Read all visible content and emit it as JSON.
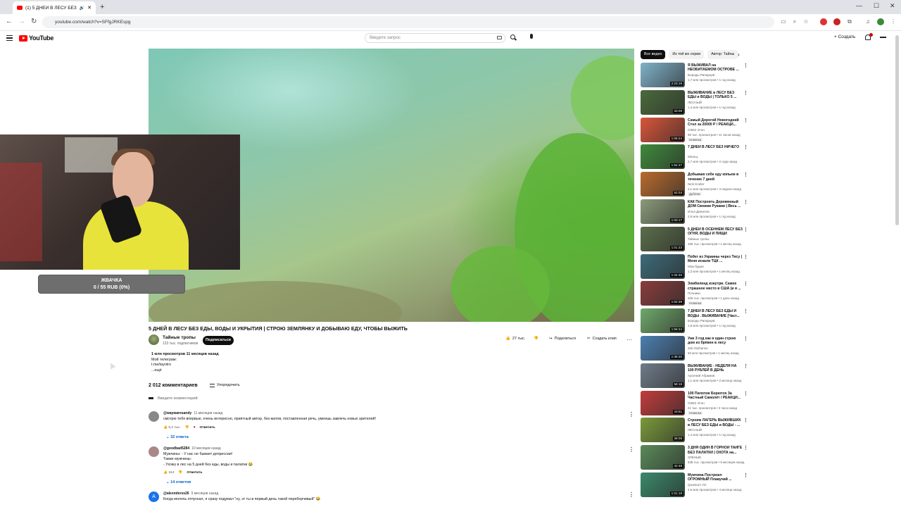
{
  "browser": {
    "tab_title": "(1) 5 ДНЕЙ В ЛЕСУ БЕЗ ЕД",
    "url": "youtube.com/watch?v=SFfgJRKEspg"
  },
  "header": {
    "logo": "YouTube",
    "search_placeholder": "Введите запрос",
    "create_label": "Создать",
    "notifications_count": "9"
  },
  "overlay": {
    "donation_title": "ЖВАЧКА",
    "donation_amount": "0 / 55 RUB (0%)",
    "donation_progress": 0
  },
  "video": {
    "title": "5 ДНЕЙ В ЛЕСУ БЕЗ ЕДЫ, ВОДЫ И УКРЫТИЯ | СТРОЮ ЗЕМЛЯНКУ И ДОБЫВАЮ ЕДУ, ЧТОБЫ ВЫЖИТЬ",
    "channel": "Тайные тропы",
    "subscribers": "123 тыс. подписчиков",
    "subscribe_label": "Подписаться",
    "likes": "27 тыс.",
    "share_label": "Поделиться",
    "clip_label": "Создать клип",
    "views_line": "1 млн просмотров  11 месяцев назад",
    "desc_lines": [
      "Мой телеграм:",
      "t.me/tayntro",
      "...ещё"
    ]
  },
  "comments": {
    "count_label": "2 012 комментариев",
    "sort_label": "Упорядочить",
    "add_placeholder": "Введите комментарий",
    "reply_label": "Ответить",
    "items": [
      {
        "author": "@waywaresandy",
        "time": "11 месяцев назад",
        "lines": [
          "смотрю тебя впервые, очень интересно, приятный автор, без матов, поставленная речь, умеешь завлечь новых зрителей!"
        ],
        "likes": "5,2 тыс.",
        "replies": "32 ответа"
      },
      {
        "author": "@goodbad5284",
        "time": "10 месяцев назад",
        "lines": [
          "Мужчины:  - У нас не бывает депрессии!",
          "Также мужчины:",
          "- Ухожу в лес на 5 дней без еды, воды и палатки 😂"
        ],
        "likes": "344",
        "replies": "14 ответов"
      },
      {
        "author": "@alexnderss26",
        "time": "9 месяцев назад",
        "lines": [
          "Когда молочь отпускал, я сразу подумал \"ну, эт ты в первый день такой переборчивый\" 😂"
        ],
        "likes": "",
        "replies": ""
      }
    ]
  },
  "sidebar": {
    "chips": [
      "Все видео",
      "Из той же серии",
      "Автор: Тайны"
    ],
    "recs": [
      {
        "title": "Я ВЫЖИВАЛ на НЕОБИТАЕМОМ ОСТРОВЕ ...",
        "channel": "Бороды Рапарцев",
        "views": "1,7 млн просмотров • 1 год назад",
        "duration": "2:23:19",
        "badge": "",
        "color": "#7fb2c9"
      },
      {
        "title": "ВЫЖИВАНИЕ в ЛЕСУ БЕЗ ЕДЫ и ВОДЫ | ТОЛЬКО 5 ...",
        "channel": "ЛЕСНЫЙ",
        "views": "1,4 млн просмотров • 1 год назад",
        "duration": "33:09",
        "badge": "",
        "color": "#4a6a3c"
      },
      {
        "title": "Самый Дорогой Новогодний Стол за 20000 Р / РЕАКЦИ...",
        "channel": "ОЗЕЗ Этон",
        "views": "95 тыс. просмотров • 11 часов назад",
        "duration": "1:06:24",
        "badge": "Новинка",
        "color": "#d9553a"
      },
      {
        "title": "7 ДНЕЙ В ЛЕСУ БЕЗ НИЧЕГО",
        "channel": "Мальц",
        "views": "2,7 млн просмотров • 2 года назад",
        "duration": "1:54:27",
        "badge": "",
        "color": "#3f8a3c"
      },
      {
        "title": "Добываю себе еду копьем в течение 7 дней",
        "channel": "Nick Kruller",
        "views": "3,1 млн просмотров • 4 недели назад",
        "duration": "52:03",
        "badge": "Дубляж",
        "color": "#b86b2e"
      },
      {
        "title": "КАК Построить Деревянный ДОМ Своими Руками | Весь ...",
        "channel": "Илья Данилов",
        "views": "2,8 млн просмотров • 1 год назад",
        "duration": "1:03:17",
        "badge": "",
        "color": "#8b9a7a"
      },
      {
        "title": "5 ДНЕЙ В ОСЕННЕМ ЛЕСУ БЕЗ ОГНЯ, ВОДЫ И ПИЩИ",
        "channel": "Тайные тропы",
        "views": "485 тыс. просмотров • 1 месяц назад",
        "duration": "1:01:23",
        "badge": "",
        "color": "#5a6e4a"
      },
      {
        "title": "Побег из Украины через Тису | Меня искали ТЦК ...",
        "channel": "Мои будни",
        "views": "1,3 млн просмотров • 1 месяц назад",
        "duration": "1:34:40",
        "badge": "",
        "color": "#3d6b7a"
      },
      {
        "title": "Зомбиленд изнутри. Самое страшное место в США (и я ...",
        "channel": "Почники",
        "views": "406 тыс. просмотров • 1 день назад",
        "duration": "1:02:39",
        "badge": "Новинка",
        "color": "#8a3c3c"
      },
      {
        "title": "7 ДНЕЙ В ЛЕСУ БЕЗ ЕДЫ И ВОДЫ . ВЫЖИВАНИЕ [Част...",
        "channel": "Бороды Рапарцев",
        "views": "1,8 млн просмотров • 1 год назад",
        "duration": "1:56:24",
        "badge": "",
        "color": "#6fa86a"
      },
      {
        "title": "Уже 3 год как я один строю дом из брёвен в лесу",
        "channel": "Jak Orphanov",
        "views": "66 млн просмотров • 1 месяц назад",
        "duration": "1:38:20",
        "badge": "",
        "color": "#4c7fb0"
      },
      {
        "title": "ВЫЖИВАНИЕ - НЕДЕЛЯ НА 100 РУБЛЕЙ В ДЕНЬ",
        "channel": "Арсений Абрамов",
        "views": "1,1 млн просмотров • 2 месяца назад",
        "duration": "58:18",
        "badge": "",
        "color": "#6f7c8a"
      },
      {
        "title": "100 Пилотов Борются За Частный Самолёт / РЕАКЦИ...",
        "channel": "ОЗЕЗ Этон",
        "views": "21 тыс. просмотров • 3 часа назад",
        "duration": "43:51",
        "badge": "Новинка",
        "color": "#c23c3c"
      },
      {
        "title": "Строим ЛАГЕРЬ ВЫЖИВШИХ в ЛЕСУ БЕЗ ЕДЫ и ВОДЫ - ...",
        "channel": "ЛЕСНЫЙ",
        "views": "1,4 млн просмотров • 1 год назад",
        "duration": "39:08",
        "badge": "",
        "color": "#7a9a3a"
      },
      {
        "title": "3 ДНЯ ОДИН В ГОРНОЙ ТАЙГЕ БЕЗ ПАЛАТКИ | ОХОТА на...",
        "channel": "ЗЛЕНЫЕ",
        "views": "838 тыс. просмотров • 9 месяцев назад",
        "duration": "42:48",
        "badge": "",
        "color": "#5a8a5a"
      },
      {
        "title": "Мужчина Построил ОГРОМНЫЙ Плавучий ...",
        "channel": "Quantum YD",
        "views": "4,6 млн просмотров • 4 месяца назад",
        "duration": "1:01:18",
        "badge": "",
        "color": "#3a8a6a"
      }
    ]
  }
}
